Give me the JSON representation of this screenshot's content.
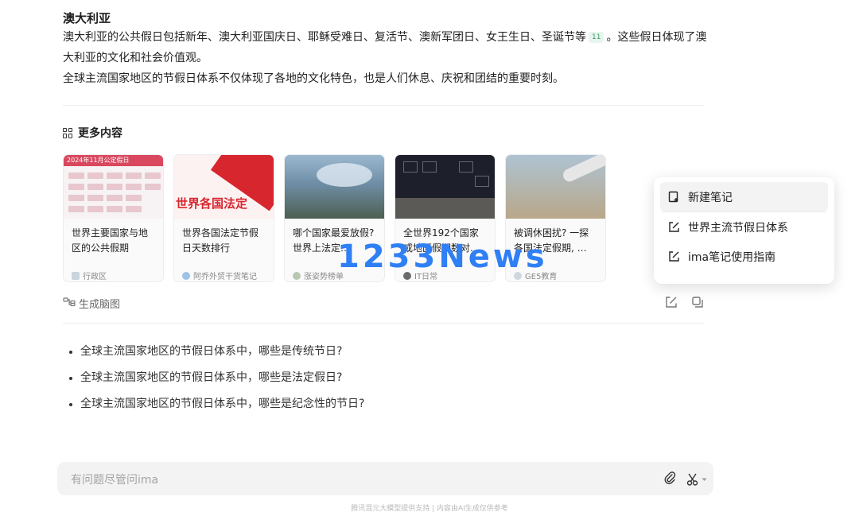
{
  "answer": {
    "heading": "澳大利亚",
    "para1": "澳大利亚的公共假日包括新年、澳大利亚国庆日、耶稣受难日、复活节、澳新军团日、女王生日、圣诞节等",
    "citation": "11",
    "para1_tail": "。这些假日体现了澳大利亚的文化和社会价值观。",
    "para2": "全球主流国家地区的节假日体系不仅体现了各地的文化特色，也是人们休息、庆祝和团结的重要时刻。"
  },
  "more": {
    "title": "更多内容",
    "cards": [
      {
        "title": "世界主要国家与地区的公共假期",
        "source": "行政区",
        "thumb_text": "2024年11月公定假日"
      },
      {
        "title": "世界各国法定节假日天数排行",
        "source": "阿乔外贸干货笔记",
        "thumb_text": "世界各国法定"
      },
      {
        "title": "哪个国家最爱放假? 世界上法定…",
        "source": "涨姿势榜单"
      },
      {
        "title": "全世界192个国家或地区假期数对…",
        "source": "IT日常"
      },
      {
        "title": "被调休困扰? 一探各国法定假期, …",
        "source": "GE5教育"
      }
    ]
  },
  "popup": {
    "items": [
      {
        "label": "新建笔记",
        "icon": "note-add-icon"
      },
      {
        "label": "世界主流节假日体系",
        "icon": "edit-note-icon"
      },
      {
        "label": "ima笔记使用指南",
        "icon": "edit-note-icon"
      }
    ]
  },
  "toolbar": {
    "mindmap_label": "生成脑图"
  },
  "questions": [
    "全球主流国家地区的节假日体系中，哪些是传统节日?",
    "全球主流国家地区的节假日体系中，哪些是法定假日?",
    "全球主流国家地区的节假日体系中，哪些是纪念性的节日?"
  ],
  "input": {
    "placeholder": "有问题尽管问ima"
  },
  "footer": "腾讯混元大模型提供支持 | 内容由AI生成仅供参考",
  "watermark": "1233News",
  "colors": {
    "accent": "#2f7ff5",
    "citation_bg": "#e8f5ee",
    "citation_fg": "#3a9a62"
  }
}
